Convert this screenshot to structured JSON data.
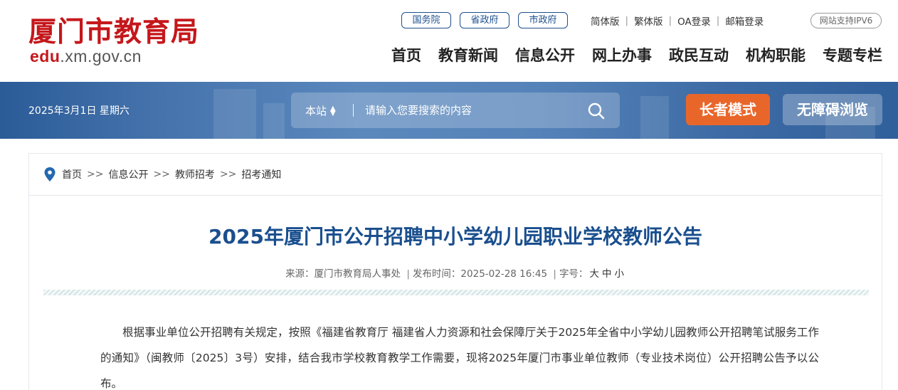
{
  "site": {
    "logo_cn": "厦门市教育局",
    "logo_url_hl": "edu",
    "logo_url_rest": ".xm.gov.cn"
  },
  "top_pills": [
    "国务院",
    "省政府",
    "市政府"
  ],
  "top_links": [
    "简体版",
    "繁体版",
    "OA登录",
    "邮箱登录"
  ],
  "ipv6_badge": "网站支持IPV6",
  "nav": [
    "首页",
    "教育新闻",
    "信息公开",
    "网上办事",
    "政民互动",
    "机构职能",
    "专题专栏"
  ],
  "banner": {
    "date": "2025年3月1日 星期六",
    "search_scope": "本站",
    "search_placeholder": "请输入您要搜索的内容",
    "elder_mode": "长者模式",
    "accessible": "无障碍浏览"
  },
  "breadcrumb": [
    "首页",
    "信息公开",
    "教师招考",
    "招考通知"
  ],
  "breadcrumb_sep": ">>",
  "article": {
    "title": "2025年厦门市公开招聘中小学幼儿园职业学校教师公告",
    "source_label": "来源：",
    "source": "厦门市教育局人事处",
    "time_label": "发布时间：",
    "time": "2025-02-28 16:45",
    "fontsize_label": "字号：",
    "fontsize_options": [
      "大",
      "中",
      "小"
    ],
    "body": "根据事业单位公开招聘有关规定，按照《福建省教育厅 福建省人力资源和社会保障厅关于2025年全省中小学幼儿园教师公开招聘笔试服务工作的通知》（闽教师〔2025〕3号）安排，结合我市学校教育教学工作需要，现将2025年厦门市事业单位教师（专业技术岗位）公开招聘公告予以公布。"
  },
  "colors": {
    "brand_red": "#c5171b",
    "title_blue": "#1a4f8e",
    "elder_orange": "#e9662a",
    "banner_blue": "#4673ac"
  }
}
